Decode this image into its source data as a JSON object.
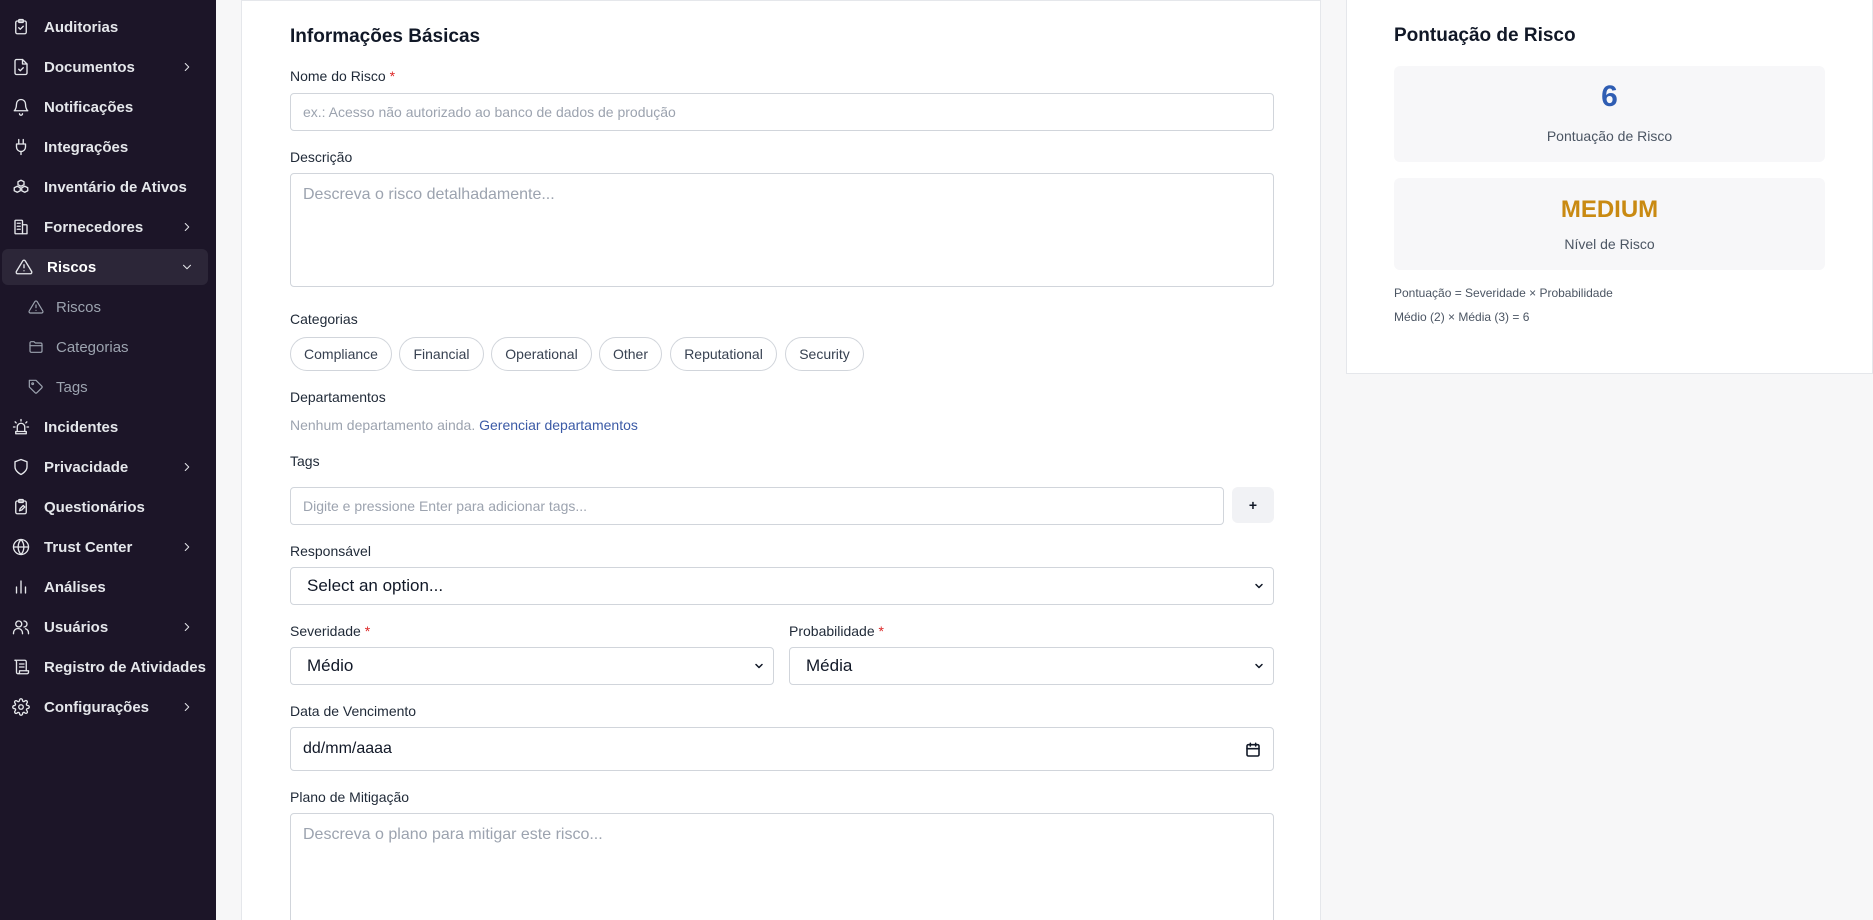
{
  "sidebar": {
    "items": [
      {
        "label": "Auditorias",
        "icon": "clipboard-check-icon",
        "has_submenu": false
      },
      {
        "label": "Documentos",
        "icon": "document-check-icon",
        "has_submenu": true
      },
      {
        "label": "Notificações",
        "icon": "bell-icon",
        "has_submenu": false
      },
      {
        "label": "Integrações",
        "icon": "plug-icon",
        "has_submenu": false
      },
      {
        "label": "Inventário de Ativos",
        "icon": "boxes-icon",
        "has_submenu": false
      },
      {
        "label": "Fornecedores",
        "icon": "building-icon",
        "has_submenu": true
      },
      {
        "label": "Riscos",
        "icon": "warning-triangle-icon",
        "has_submenu": true,
        "expanded": true,
        "active": true
      },
      {
        "label": "Incidentes",
        "icon": "siren-icon",
        "has_submenu": false
      },
      {
        "label": "Privacidade",
        "icon": "shield-icon",
        "has_submenu": true
      },
      {
        "label": "Questionários",
        "icon": "clipboard-pen-icon",
        "has_submenu": false
      },
      {
        "label": "Trust Center",
        "icon": "globe-icon",
        "has_submenu": true
      },
      {
        "label": "Análises",
        "icon": "bar-chart-icon",
        "has_submenu": false
      },
      {
        "label": "Usuários",
        "icon": "users-icon",
        "has_submenu": true
      },
      {
        "label": "Registro de Atividades",
        "icon": "scroll-log-icon",
        "has_submenu": false
      },
      {
        "label": "Configurações",
        "icon": "gear-icon",
        "has_submenu": true
      }
    ],
    "sub_items": [
      {
        "label": "Riscos",
        "icon": "warning-triangle-icon"
      },
      {
        "label": "Categorias",
        "icon": "folder-icon"
      },
      {
        "label": "Tags",
        "icon": "tag-icon"
      }
    ]
  },
  "form": {
    "section_title": "Informações Básicas",
    "risk_name": {
      "label": "Nome do Risco",
      "required_mark": "*",
      "placeholder": "ex.: Acesso não autorizado ao banco de dados de produção",
      "value": ""
    },
    "description": {
      "label": "Descrição",
      "placeholder": "Descreva o risco detalhadamente..."
    },
    "categories": {
      "label": "Categorias",
      "options": [
        "Compliance",
        "Financial",
        "Operational",
        "Other",
        "Reputational",
        "Security"
      ]
    },
    "departments": {
      "label": "Departamentos",
      "empty_text": "Nenhum departamento ainda.",
      "manage_link": "Gerenciar departamentos"
    },
    "tags": {
      "label": "Tags",
      "placeholder": "Digite e pressione Enter para adicionar tags...",
      "add_button": "+"
    },
    "owner": {
      "label": "Responsável",
      "selected": "Select an option..."
    },
    "severity": {
      "label": "Severidade",
      "required_mark": "*",
      "selected": "Médio"
    },
    "probability": {
      "label": "Probabilidade",
      "required_mark": "*",
      "selected": "Média"
    },
    "due_date": {
      "label": "Data de Vencimento",
      "placeholder": "dd/mm/aaaa"
    },
    "mitigation": {
      "label": "Plano de Mitigação",
      "placeholder": "Descreva o plano para mitigar este risco..."
    }
  },
  "score_panel": {
    "title": "Pontuação de Risco",
    "score_value": "6",
    "score_label": "Pontuação de Risco",
    "level_value": "MEDIUM",
    "level_label": "Nível de Risco",
    "formula_line": "Pontuação = Severidade × Probabilidade",
    "calc_line": "Médio (2) × Média (3) = 6"
  },
  "colors": {
    "sidebar_bg": "#1c1528",
    "sidebar_active_bg": "#2c2638",
    "score_blue": "#2f5db3",
    "level_orange": "#c98a12",
    "link_blue": "#3b5aa6",
    "required_red": "#dc2626"
  }
}
